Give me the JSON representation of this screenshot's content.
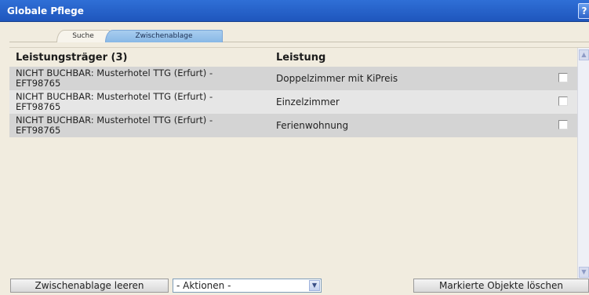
{
  "window": {
    "title": "Globale Pflege",
    "help_label": "?"
  },
  "tabs": [
    {
      "label": "Suche"
    },
    {
      "label": "Zwischenablage"
    }
  ],
  "table": {
    "headers": {
      "traeger": "Leistungsträger (3)",
      "leistung": "Leistung"
    },
    "rows": [
      {
        "traeger_line1": "NICHT BUCHBAR: Musterhotel TTG (Erfurt) -",
        "traeger_line2": "EFT98765",
        "leistung": "Doppelzimmer mit KiPreis"
      },
      {
        "traeger_line1": "NICHT BUCHBAR: Musterhotel TTG (Erfurt) -",
        "traeger_line2": "EFT98765",
        "leistung": "Einzelzimmer"
      },
      {
        "traeger_line1": "NICHT BUCHBAR: Musterhotel TTG (Erfurt) -",
        "traeger_line2": "EFT98765",
        "leistung": "Ferienwohnung"
      }
    ]
  },
  "footer": {
    "clear_label": "Zwischenablage leeren",
    "actions_value": "- Aktionen -",
    "delete_label": "Markierte Objekte löschen"
  },
  "colors": {
    "titlebar": "#2f6fd6",
    "active_tab": "#a8cdef",
    "row_odd": "#d4d4d4",
    "row_even": "#e6e6e6"
  }
}
